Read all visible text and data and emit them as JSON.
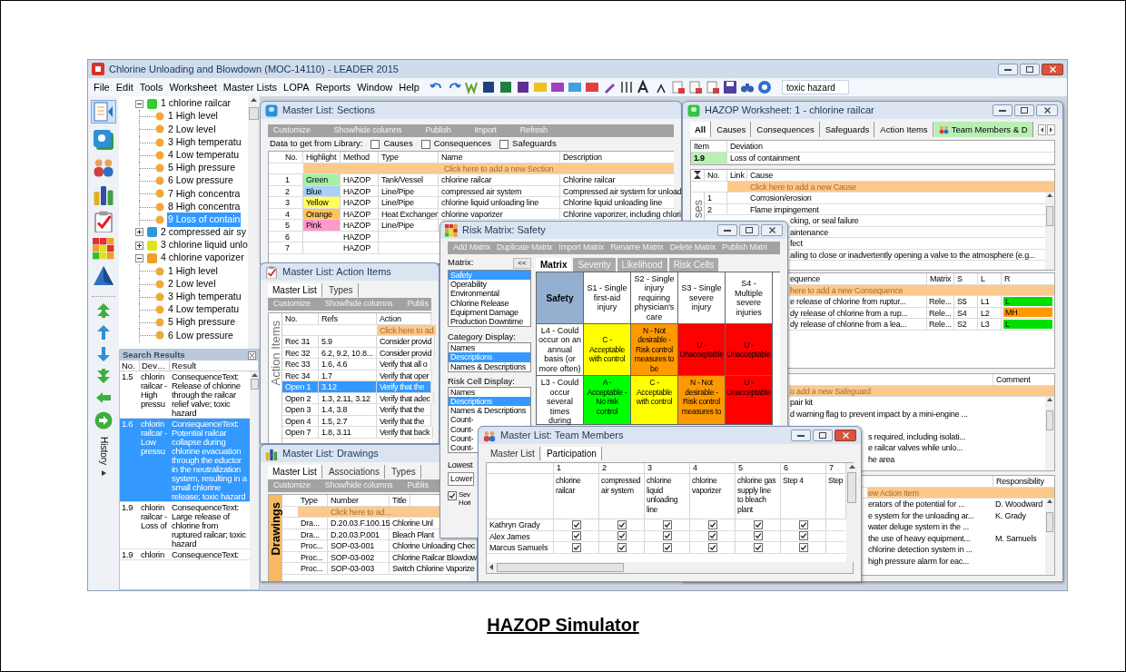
{
  "app": {
    "title": "Chlorine Unloading and Blowdown (MOC-14110) - LEADER 2015",
    "menu": [
      "File",
      "Edit",
      "Tools",
      "Worksheet",
      "Master Lists",
      "LOPA",
      "Reports",
      "Window",
      "Help"
    ],
    "search": {
      "value": "toxic hazard"
    }
  },
  "tree": [
    {
      "label": "1 chlorine railcar",
      "color": "#33cc33",
      "expanded": true,
      "children": [
        {
          "label": "1 High level",
          "selected": false
        },
        {
          "label": "2 Low level",
          "selected": false
        },
        {
          "label": "3 High temperatu",
          "selected": false
        },
        {
          "label": "4 Low temperatu",
          "selected": false
        },
        {
          "label": "5 High pressure",
          "selected": false
        },
        {
          "label": "6 Low pressure",
          "selected": false
        },
        {
          "label": "7 High concentra",
          "selected": false
        },
        {
          "label": "8 High concentra",
          "selected": false
        },
        {
          "label": "9 Loss of contain",
          "selected": true
        }
      ]
    },
    {
      "label": "2 compressed air sy",
      "color": "#2f95de",
      "expanded": false
    },
    {
      "label": "3 chlorine liquid unlo",
      "color": "#e2e21a",
      "expanded": false
    },
    {
      "label": "4 chlorine vaporizer",
      "color": "#f0a020",
      "expanded": true,
      "children": [
        {
          "label": "1 High level",
          "selected": false
        },
        {
          "label": "2 Low level",
          "selected": false
        },
        {
          "label": "3 High temperatu",
          "selected": false
        },
        {
          "label": "4 Low temperatu",
          "selected": false
        },
        {
          "label": "5 High pressure",
          "selected": false
        },
        {
          "label": "6 Low pressure",
          "selected": false
        }
      ]
    }
  ],
  "history": "History",
  "search_results": {
    "title": "Search Results",
    "columns": [
      "No.",
      "Dev…",
      "Result"
    ],
    "rows": [
      {
        "no": "1.5",
        "deviation": "chlorin railcar - High pressu",
        "result": "ConsequenceText: Release of chlorine through the railcar relief valve; toxic hazard",
        "selected": false
      },
      {
        "no": "1.6",
        "deviation": "chlorin railcar - Low pressu",
        "result": "ConsequenceText: Potential railcar collapse during chlorine evacuation through the eductor in the neutralization system, resulting in a small chlorine release; toxic hazard",
        "selected": true
      },
      {
        "no": "1.9",
        "deviation": "chlorin railcar - Loss of",
        "result": "ConsequenceText: Large release of chlorine from ruptured railcar; toxic hazard",
        "selected": false
      },
      {
        "no": "1.9",
        "deviation": "chlorin",
        "result": "ConsequenceText:",
        "selected": false
      }
    ]
  },
  "sections": {
    "title": "Master List: Sections",
    "toolbar": [
      "Customize",
      "Show/hide columns",
      "Publish",
      "Import",
      "Refresh"
    ],
    "library": {
      "label": "Data to get from Library:",
      "options": [
        {
          "label": "Causes",
          "checked": false
        },
        {
          "label": "Consequences",
          "checked": false
        },
        {
          "label": "Safeguards",
          "checked": false
        }
      ]
    },
    "columns": [
      "No.",
      "Highlight",
      "Method",
      "Type",
      "Name",
      "Description"
    ],
    "add_row": "Click here to add a new Section",
    "rows": [
      {
        "no": "1",
        "highlight": "Green",
        "color": "#a6efa6",
        "method": "HAZOP",
        "type": "Tank/Vessel",
        "name": "chlorine railcar",
        "description": "Chlorine railcar"
      },
      {
        "no": "2",
        "highlight": "Blue",
        "color": "#a9d1f7",
        "method": "HAZOP",
        "type": "Line/Pipe",
        "name": "compressed air system",
        "description": "Compressed air system for unload"
      },
      {
        "no": "3",
        "highlight": "Yellow",
        "color": "#ffff5c",
        "method": "HAZOP",
        "type": "Line/Pipe",
        "name": "chlorine liquid unloading line",
        "description": "Chlorine liquid unloading line"
      },
      {
        "no": "4",
        "highlight": "Orange",
        "color": "#ffc35c",
        "method": "HAZOP",
        "type": "Heat Exchanger",
        "name": "chlorine vaporizer",
        "description": "Chlorine vaporizer, including chlori"
      },
      {
        "no": "5",
        "highlight": "Pink",
        "color": "#ff99cc",
        "method": "HAZOP",
        "type": "Line/Pipe"
      },
      {
        "no": "6",
        "method": "HAZOP"
      },
      {
        "no": "7",
        "method": "HAZOP"
      }
    ]
  },
  "action_items": {
    "title": "Master List: Action Items",
    "tabs": [
      {
        "label": "Master List",
        "selected": true
      },
      {
        "label": "Types",
        "selected": false
      }
    ],
    "toolbar": [
      "Customize",
      "Show/hide columns",
      "Publis"
    ],
    "side_label": "Action Items",
    "columns": [
      "No.",
      "Refs",
      "Action"
    ],
    "add_row": "Click here to ad",
    "rows": [
      {
        "no": "Rec 31",
        "refs": "5.9",
        "action": "Consider provid",
        "selected": false
      },
      {
        "no": "Rec 32",
        "refs": "6.2, 9.2, 10.8...",
        "action": "Consider provid",
        "selected": false
      },
      {
        "no": "Rec 33",
        "refs": "1.6, 4.6",
        "action": "Verify that all o",
        "selected": false
      },
      {
        "no": "Rec 34",
        "refs": "1.7",
        "action": "Verify that oper",
        "selected": false
      },
      {
        "no": "Open 1",
        "refs": "3.12",
        "action": "Verify that the",
        "selected": true
      },
      {
        "no": "Open 2",
        "refs": "1.3, 2.11, 3.12",
        "action": "Verify that adec",
        "selected": false
      },
      {
        "no": "Open 3",
        "refs": "1.4, 3.8",
        "action": "Verify that the",
        "selected": false
      },
      {
        "no": "Open 4",
        "refs": "1.5, 2.7",
        "action": "Verify that the",
        "selected": false
      },
      {
        "no": "Open 7",
        "refs": "1.8, 3.11",
        "action": "Verify that back",
        "selected": false
      }
    ]
  },
  "drawings": {
    "title": "Master List: Drawings",
    "tabs": [
      {
        "label": "Master List",
        "selected": true
      },
      {
        "label": "Associations",
        "selected": false
      },
      {
        "label": "Types",
        "selected": false
      }
    ],
    "toolbar": [
      "Customize",
      "Show/hide columns",
      "Publis"
    ],
    "side_label": "Drawings",
    "columns": [
      "Type",
      "Number",
      "Title"
    ],
    "add_row": "Click here to ad...",
    "rows": [
      {
        "type": "Dra...",
        "number": "D.20.03.F.100.15",
        "title": "Chlorine Unl"
      },
      {
        "type": "Dra...",
        "number": "D.20.03.P.001",
        "title": "Bleach Plant"
      },
      {
        "type": "Proc...",
        "number": "SOP-03-001",
        "title": "Chlorine Unloading Chec"
      },
      {
        "type": "Proc...",
        "number": "SOP-03-002",
        "title": "Chlorine Railcar Blowdow"
      },
      {
        "type": "Proc...",
        "number": "SOP-03-003",
        "title": "Switch Chlorine Vaporize"
      }
    ]
  },
  "risk_matrix": {
    "title": "Risk Matrix: Safety",
    "toolbar": [
      "Add Matrix",
      "Duplicate Matrix",
      "Import Matrix",
      "Rename Matrix",
      "Delete Matrix",
      "Publish Matri"
    ],
    "matrix_list": {
      "label": "Matrix:",
      "collapse": "<<",
      "items": [
        {
          "label": "Safety",
          "selected": true
        },
        {
          "label": "Operability",
          "selected": false
        },
        {
          "label": "Environmental",
          "selected": false
        },
        {
          "label": "Chlorine Release",
          "selected": false
        },
        {
          "label": "Equipment Damage",
          "selected": false
        },
        {
          "label": "Production Downtime",
          "selected": false
        }
      ]
    },
    "category_display": {
      "label": "Category Display:",
      "items": [
        {
          "label": "Names",
          "selected": false
        },
        {
          "label": "Descriptions",
          "selected": true
        },
        {
          "label": "Names & Descriptions",
          "selected": false
        }
      ]
    },
    "risk_cell_display": {
      "label": "Risk Cell Display:",
      "items": [
        {
          "label": "Names",
          "selected": false
        },
        {
          "label": "Descriptions",
          "selected": true
        },
        {
          "label": "Names & Descriptions",
          "selected": false
        },
        {
          "label": "Count-",
          "selected": false
        },
        {
          "label": "Count-",
          "selected": false
        },
        {
          "label": "Count-",
          "selected": false
        },
        {
          "label": "Count-",
          "selected": false
        }
      ]
    },
    "lowest": {
      "label": "Lowest",
      "value": "Lower"
    },
    "severity_option": {
      "label": "Sev Hori",
      "checked": true
    },
    "tabs": [
      {
        "label": "Matrix",
        "selected": true
      },
      {
        "label": "Severity",
        "selected": false
      },
      {
        "label": "Likelihood",
        "selected": false
      },
      {
        "label": "Risk Cells",
        "selected": false
      }
    ],
    "matrix": {
      "corner": "Safety",
      "severities": [
        "S1 - Single first-aid injury",
        "S2 - Single injury requiring physician's care",
        "S3 - Single severe injury",
        "S4 - Multiple severe injuries"
      ],
      "rows": [
        {
          "likelihood": "L4 - Could occur on an annual basis (or more often)",
          "cells": [
            {
              "text": "C - Acceptable with control",
              "color": "#ffff00"
            },
            {
              "text": "N - Not desirable - Risk control measures to be",
              "color": "#ff9900"
            },
            {
              "text": "U - Unacceptable",
              "color": "#ff0000"
            },
            {
              "text": "U - Unacceptable",
              "color": "#ff0000"
            }
          ]
        },
        {
          "likelihood": "L3 - Could occur several times during",
          "cells": [
            {
              "text": "A - Acceptable - No risk control",
              "color": "#00ff00"
            },
            {
              "text": "C - Acceptable with control",
              "color": "#ffff00"
            },
            {
              "text": "N - Not desirable - Risk control measures to",
              "color": "#ff9900"
            },
            {
              "text": "U - Unacceptable",
              "color": "#ff0000"
            }
          ]
        }
      ]
    }
  },
  "worksheet": {
    "title": "HAZOP Worksheet: 1 - chlorine railcar",
    "tabs": [
      {
        "label": "All",
        "selected": true
      },
      {
        "label": "Causes",
        "selected": false
      },
      {
        "label": "Consequences",
        "selected": false
      },
      {
        "label": "Safeguards",
        "selected": false
      },
      {
        "label": "Action Items",
        "selected": false
      },
      {
        "label": "Team Members & D",
        "selected": false
      }
    ],
    "item": {
      "columns": [
        "Item",
        "Deviation"
      ],
      "no": "1.9",
      "deviation": "Loss of containment"
    },
    "causes": {
      "side_label": "ses",
      "columns": [
        "No.",
        "Link",
        "Cause"
      ],
      "add_row": "Click here to add a new Cause",
      "rows": [
        {
          "no": "1",
          "cause": "Corrosion/erosion"
        },
        {
          "no": "2",
          "cause": "Flame impingement"
        },
        {
          "cause": "cking, or seal failure"
        },
        {
          "cause": "aintenance"
        },
        {
          "cause": "fect"
        },
        {
          "cause": "ailing to close or inadvertently opening a valve to the atmosphere (e.g..."
        }
      ]
    },
    "consequences": {
      "columns": [
        "equence",
        "Matrix",
        "S",
        "L",
        "R"
      ],
      "add_row": "here to add a new Consequence",
      "rows": [
        {
          "consequence": "e release of chlorine from ruptur...",
          "matrix": "Rele...",
          "s": "S5",
          "l": "L1",
          "r": "L",
          "color": "#00e000"
        },
        {
          "consequence": "dy release of chlorine from a rup...",
          "matrix": "Rele...",
          "s": "S4",
          "l": "L2",
          "r": "MH",
          "color": "#ff9900"
        },
        {
          "consequence": "dy release of chlorine from a lea...",
          "matrix": "Rele...",
          "s": "S2",
          "l": "L3",
          "r": "L",
          "color": "#00e000"
        }
      ]
    },
    "safeguards": {
      "columns": [
        "Comment"
      ],
      "add_row": "o add a new Safeguard",
      "rows": [
        "pair kit",
        "d warning flag to prevent impact by a mini-engine ...",
        "s required, including isolati...",
        "e railcar valves while unlo...",
        "he area"
      ]
    },
    "action_items": {
      "columns": [
        "Responsibility"
      ],
      "add_row": "ew Action Item",
      "rows": [
        {
          "action": "erators of the potential for ...",
          "responsibility": "D. Woodward"
        },
        {
          "action": "e system for the unloading ar...",
          "responsibility": "K. Grady"
        },
        {
          "action": "water deluge system in the ..."
        },
        {
          "action": "the use of heavy equipment...",
          "responsibility": "M. Samuels"
        },
        {
          "action": "chlorine detection system in ..."
        },
        {
          "action": "high pressure alarm for eac..."
        }
      ]
    }
  },
  "team_members": {
    "title": "Master List: Team Members",
    "tabs": [
      {
        "label": "Master List",
        "selected": false
      },
      {
        "label": "Participation",
        "selected": true
      }
    ],
    "columns": [
      {
        "no": "1",
        "name": "chlorine railcar"
      },
      {
        "no": "2",
        "name": "compressed air system"
      },
      {
        "no": "3",
        "name": "chlorine liquid unloading line"
      },
      {
        "no": "4",
        "name": "chlorine vaporizer"
      },
      {
        "no": "5",
        "name": "chlorine gas supply line to bleach plant"
      },
      {
        "no": "6",
        "name": "Step 4"
      },
      {
        "no": "7",
        "name": "Step"
      }
    ],
    "members": [
      {
        "name": "Kathryn Grady",
        "checks": [
          true,
          true,
          true,
          true,
          true,
          true
        ]
      },
      {
        "name": "Alex James",
        "checks": [
          true,
          true,
          true,
          true,
          true,
          true
        ]
      },
      {
        "name": "Marcus Samuels",
        "checks": [
          true,
          true,
          true,
          true,
          true,
          true
        ]
      }
    ]
  },
  "caption": "HAZOP Simulator"
}
